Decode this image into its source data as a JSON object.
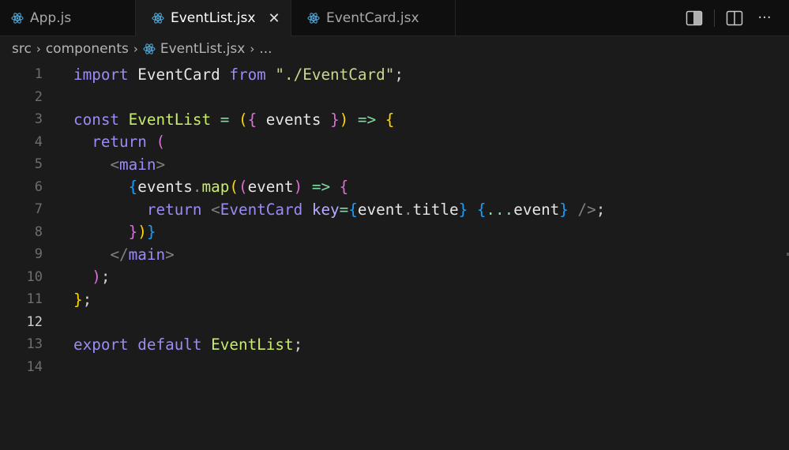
{
  "tabs": [
    {
      "label": "App.js",
      "icon": "react-icon",
      "active": false
    },
    {
      "label": "EventList.jsx",
      "icon": "react-icon",
      "active": true
    },
    {
      "label": "EventCard.jsx",
      "icon": "react-icon",
      "active": false
    }
  ],
  "close_glyph": "✕",
  "actions": [
    "toggle-secondary-sidebar-icon",
    "split-editor-icon",
    "more-actions-icon"
  ],
  "more_glyph": "···",
  "breadcrumb": {
    "items": [
      "src",
      "components",
      "EventList.jsx",
      "..."
    ],
    "separator": "›"
  },
  "current_line": 12,
  "code": [
    {
      "n": "1",
      "tokens": [
        [
          "import",
          "kw"
        ],
        [
          " "
        ],
        [
          "EventCard",
          "var"
        ],
        [
          " "
        ],
        [
          "from",
          "kw"
        ],
        [
          " "
        ],
        [
          "\"./EventCard\"",
          "str"
        ],
        [
          ";",
          "punc"
        ]
      ]
    },
    {
      "n": "2",
      "tokens": []
    },
    {
      "n": "3",
      "tokens": [
        [
          "const",
          "kw"
        ],
        [
          " "
        ],
        [
          "EventList",
          "fn"
        ],
        [
          " "
        ],
        [
          "=",
          "op"
        ],
        [
          " "
        ],
        [
          "(",
          "b1"
        ],
        [
          "{",
          "b2"
        ],
        [
          " events ",
          "var"
        ],
        [
          "}",
          "b2"
        ],
        [
          ")",
          "b1"
        ],
        [
          " "
        ],
        [
          "=>",
          "op"
        ],
        [
          " "
        ],
        [
          "{",
          "b1"
        ]
      ]
    },
    {
      "n": "4",
      "tokens": [
        [
          "  "
        ],
        [
          "return",
          "kw"
        ],
        [
          " "
        ],
        [
          "(",
          "b2"
        ]
      ]
    },
    {
      "n": "5",
      "tokens": [
        [
          "    "
        ],
        [
          "<",
          "tag"
        ],
        [
          "main",
          "jsx"
        ],
        [
          ">",
          "tag"
        ]
      ]
    },
    {
      "n": "6",
      "tokens": [
        [
          "      "
        ],
        [
          "{",
          "b3"
        ],
        [
          "events",
          "var"
        ],
        [
          ".",
          "dot"
        ],
        [
          "map",
          "fn"
        ],
        [
          "(",
          "b1"
        ],
        [
          "(",
          "b2"
        ],
        [
          "event",
          "var"
        ],
        [
          ")",
          "b2"
        ],
        [
          " "
        ],
        [
          "=>",
          "op"
        ],
        [
          " "
        ],
        [
          "{",
          "b2"
        ]
      ]
    },
    {
      "n": "7",
      "tokens": [
        [
          "        "
        ],
        [
          "return",
          "kw"
        ],
        [
          " "
        ],
        [
          "<",
          "tag"
        ],
        [
          "EventCard",
          "jsx"
        ],
        [
          " "
        ],
        [
          "key",
          "attr"
        ],
        [
          "=",
          "op"
        ],
        [
          "{",
          "b3"
        ],
        [
          "event",
          "var"
        ],
        [
          ".",
          "dot"
        ],
        [
          "title",
          "var"
        ],
        [
          "}",
          "b3"
        ],
        [
          " "
        ],
        [
          "{",
          "b3"
        ],
        [
          "...",
          "op"
        ],
        [
          "event",
          "var"
        ],
        [
          "}",
          "b3"
        ],
        [
          " "
        ],
        [
          "/>",
          "tag"
        ],
        [
          ";",
          "punc"
        ]
      ]
    },
    {
      "n": "8",
      "tokens": [
        [
          "      "
        ],
        [
          "}",
          "b2"
        ],
        [
          ")",
          "b1"
        ],
        [
          "}",
          "b3"
        ]
      ]
    },
    {
      "n": "9",
      "tokens": [
        [
          "    "
        ],
        [
          "</",
          "tag"
        ],
        [
          "main",
          "jsx"
        ],
        [
          ">",
          "tag"
        ]
      ]
    },
    {
      "n": "10",
      "tokens": [
        [
          "  "
        ],
        [
          ")",
          "b2"
        ],
        [
          ";",
          "punc"
        ]
      ]
    },
    {
      "n": "11",
      "tokens": [
        [
          "}",
          "b1"
        ],
        [
          ";",
          "punc"
        ]
      ]
    },
    {
      "n": "12",
      "tokens": []
    },
    {
      "n": "13",
      "tokens": [
        [
          "export",
          "kw"
        ],
        [
          " "
        ],
        [
          "default",
          "kw"
        ],
        [
          " "
        ],
        [
          "EventList",
          "fn"
        ],
        [
          ";",
          "punc"
        ]
      ]
    },
    {
      "n": "14",
      "tokens": []
    }
  ]
}
